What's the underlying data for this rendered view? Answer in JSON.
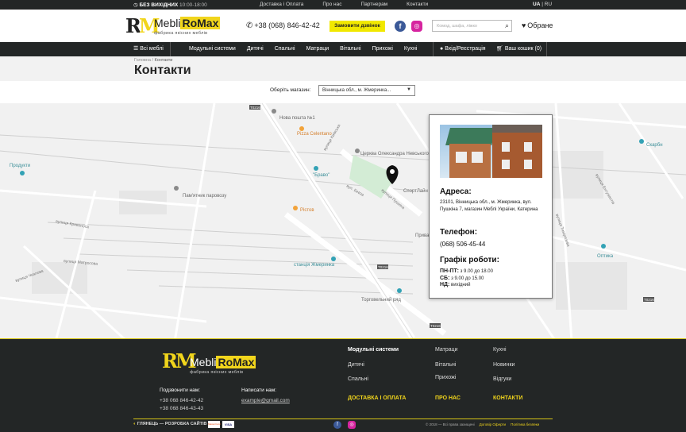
{
  "topbar": {
    "hours_label": "БЕЗ ВИХІДНИХ",
    "hours_value": "10:00-18:00",
    "nav": [
      "Доставка і Оплата",
      "Про нас",
      "Партнерам",
      "Контакти"
    ],
    "lang_active": "UA",
    "lang_sep": " | ",
    "lang_other": "RU"
  },
  "header": {
    "logo_word": "Mebli",
    "logo_word_highlight": "RoMax",
    "logo_sub": "фабрика якісних меблів",
    "phone": "+38 (068) 846-42-42",
    "callback_button": "Замовити дзвінок",
    "search_placeholder": "Комод, шафа, ліжко",
    "favorites": "Обране"
  },
  "menu": {
    "all_furniture": "Всі меблі",
    "items": [
      "Модульні системи",
      "Дитячі",
      "Спальні",
      "Матраци",
      "Вітальні",
      "Прихожі",
      "Кухні"
    ],
    "account": "Вхід/Реєстрація",
    "cart": "Ваш кошик (0)"
  },
  "breadcrumbs": {
    "home": "Головна",
    "sep": " / ",
    "current": "Контакти"
  },
  "page": {
    "title": "Контакти",
    "store_label": "Оберіть магазин:",
    "store_selected": "Вінницька обл., м. Жмеринка..."
  },
  "map": {
    "labels": [
      "Нова пошта №1",
      "Pizza Celentano",
      "Церква Олександра Невського",
      "\"Браво\"",
      "Продукти",
      "Пам'ятник паровозу",
      "Рістов",
      "станція Жмеринка",
      "Торговельний ряд",
      "СпортЛайн",
      "Прива",
      "Скарбн",
      "Оптика",
      "вулиця Київська",
      "вулиця Пушкіна",
      "вул. Бевза",
      "вулиця Кривоноса",
      "вулиця Матросова",
      "вулиця Чкалова",
      "вулиця Тимірязєва",
      "вулиця Ентузіастів"
    ],
    "road_badges": [
      "T0216",
      "T0216",
      "T0216",
      "T0216"
    ]
  },
  "store_card": {
    "address_title": "Адреса:",
    "address": "23101, Вінницька обл., м. Жмеринка, вул. Пушкіна 7, магазин Меблі України, Катерина",
    "phone_title": "Телефон:",
    "phone": "(068) 506-45-44",
    "schedule_title": "Графік роботи:",
    "schedule": [
      {
        "day": "ПН-ПТ:",
        "time": "з 9.00 до 18.00"
      },
      {
        "day": "СБ:",
        "time": "з 9.00 до 15.00"
      },
      {
        "day": "НД:",
        "time": "вихідний"
      }
    ]
  },
  "footer": {
    "logo_word": "Mebli",
    "logo_word_highlight": "RoMax",
    "logo_sub": "фабрика якісних меблів",
    "call_title": "Подзвонити нам:",
    "phones": [
      "+38 068 846-42-42",
      "+38 068 846-43-43"
    ],
    "write_title": "Написати нам:",
    "email": "example@gmail.com",
    "menu_col1": [
      "Модульні системи",
      "Дитячі",
      "Спальні"
    ],
    "menu_col2": [
      "Матраци",
      "Вітальні",
      "Прихожі"
    ],
    "menu_col3": [
      "Кухні",
      "Новинки",
      "Відгуки"
    ],
    "link_delivery": "ДОСТАВКА І ОПЛАТА",
    "link_about": "ПРО НАС",
    "link_contacts": "КОНТАКТИ",
    "dev_credit": "ГЛЯНЕЦЬ — РОЗРОБКА САЙТІВ",
    "cards": [
      "MasterCard",
      "VISA"
    ],
    "copyright": "© 2018 — Всі права захищені",
    "offer_link": "Договір Оферти",
    "privacy_link": "Політика безпеки"
  },
  "colors": {
    "accent": "#f1d51c",
    "dark": "#232626",
    "facebook": "#3b5998",
    "instagram": "#d6249f"
  }
}
